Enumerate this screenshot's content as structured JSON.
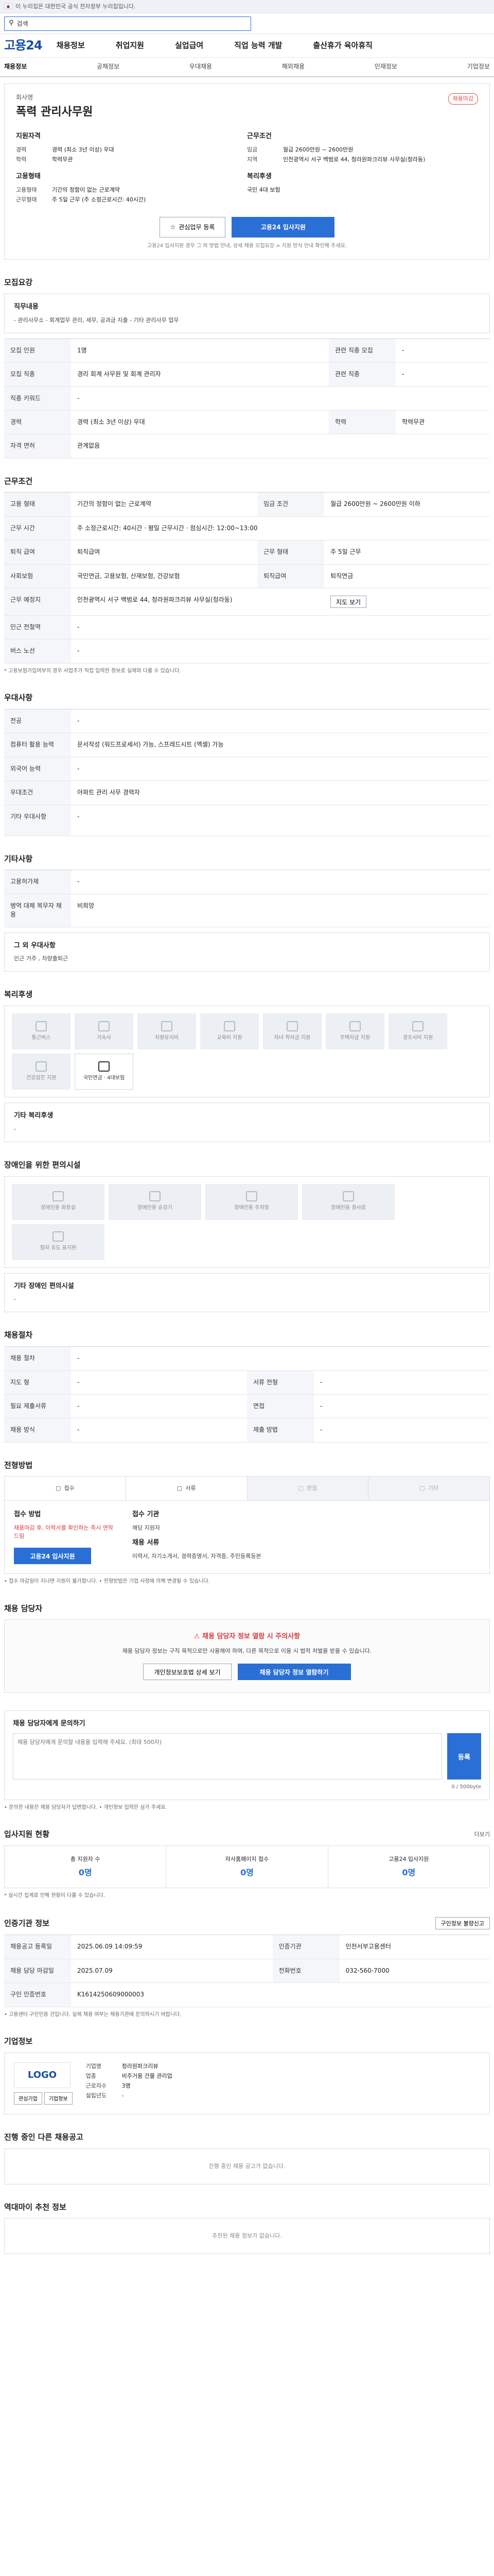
{
  "topbar": {
    "text": "이 누리집은 대한민국 공식 전자정부 누리집입니다."
  },
  "search": {
    "value": "검색",
    "placeholder": "검색어를 입력하세요"
  },
  "nav": {
    "logo": "고용24",
    "items": [
      "채용정보",
      "취업지원",
      "실업급여",
      "직업 능력 개발",
      "출산휴가 육아휴직"
    ]
  },
  "subnav": [
    "채용정보",
    "공채정보",
    "우대채용",
    "해외채용",
    "인재정보",
    "기업정보"
  ],
  "job": {
    "company": "회사명",
    "title": "폭력 관리사무원",
    "badge": "채용마감",
    "left_title": "지원자격",
    "left": [
      {
        "k": "경력",
        "v": "경력 (최소 3년 이상) 우대"
      },
      {
        "k": "학력",
        "v": "학력무관"
      }
    ],
    "left2_title": "고용형태",
    "left2": [
      {
        "k": "고용형태",
        "v": "기간의 정함이 없는 근로계약"
      },
      {
        "k": "근무형태",
        "v": "주 5일 근무 (주 소정근로시간: 40시간)"
      }
    ],
    "right_title": "근무조건",
    "right": [
      {
        "k": "임금",
        "v": "월급 2600만원 ~ 2600만원"
      },
      {
        "k": "지역",
        "v": "인천광역시 서구 백범로 44, 청라원파크리뷰 사무실(청라동)"
      }
    ],
    "right2_title": "복리후생",
    "right2": [
      {
        "k": "",
        "v": "국민 4대 보험"
      }
    ],
    "btn_interest": "관심업무 등록",
    "btn_apply": "고용24 입사지원",
    "apply_note": "고용24 입사지원 경우 그 외 방법 안내, 상세 채용 모집요강 > 지원 방식 안내 확인해 주세요."
  },
  "recruit": {
    "title": "모집요강",
    "duty_h": "직무내용",
    "duty": "- 관리사무소 - 회계업무 관리, 세무, 공과금 지출 - 기타 관리사무 업무",
    "rows": [
      {
        "th": "모집 인원",
        "td": "1명",
        "th2": "관련 직종 모집",
        "td2": "-"
      },
      {
        "th": "모집 직종",
        "td": "경리 회계 사무원 및 회계 관리자",
        "th2": "관련 직종",
        "td2": "-"
      },
      {
        "th": "직종 키워드",
        "td": "-",
        "th2": "",
        "td2": ""
      },
      {
        "th": "경력",
        "td": "경력 (최소 3년 이상) 우대",
        "th2": "학력",
        "td2": "학력무관"
      },
      {
        "th": "자격 면허",
        "td": "관계없음",
        "th2": "",
        "td2": ""
      }
    ]
  },
  "conditions": {
    "title": "근무조건",
    "rows": [
      {
        "th": "고용 형태",
        "td": "기간의 정함이 없는 근로계약",
        "th2": "임금 조건",
        "td2": "월급 2600만원 ~ 2600만원 이하"
      },
      {
        "th": "근무 시간",
        "td": "주 소정근로시간: 40시간 · 평일 근무시간 · 점심시간: 12:00~13:00",
        "th2": "",
        "td2": ""
      },
      {
        "th": "퇴직 급여",
        "td": "퇴직급여",
        "th2": "근무 형태",
        "td2": "주 5일 근무"
      },
      {
        "th": "사회보험",
        "td": "국민연금, 고용보험, 산재보험, 건강보험",
        "th2": "퇴직급여",
        "td2": "퇴직연금"
      },
      {
        "th": "근무 예정지",
        "td": "인천광역시 서구 백범로 44, 청라원파크리뷰 사무실(청라동)",
        "th2": "",
        "td2": ""
      },
      {
        "th": "인근 전철역",
        "td": "-",
        "th2": "",
        "td2": ""
      },
      {
        "th": "버스 노선",
        "td": "-",
        "th2": "",
        "td2": ""
      }
    ],
    "map_btn": "지도 보기",
    "note": "* 고용보험가입여부의 경우 사업주가 직접 입력한 정보로 실제와 다를 수 있습니다."
  },
  "pref": {
    "title": "우대사항",
    "rows": [
      {
        "th": "전공",
        "td": "-"
      },
      {
        "th": "컴퓨터 활용 능력",
        "td": "문서작성 (워드프로세서) 가능, 스프레드시트 (엑셀) 가능"
      },
      {
        "th": "외국어 능력",
        "td": "-"
      },
      {
        "th": "우대조건",
        "td": "아파트 관리 사무 경력자"
      },
      {
        "th": "기타 우대사항",
        "td": "-"
      }
    ]
  },
  "etc": {
    "title": "기타사항",
    "rows": [
      {
        "th": "고용허가제",
        "td": "-"
      },
      {
        "th": "병역 대체 복무자 채용",
        "td": "비희망"
      }
    ],
    "other_h": "그 외 우대사항",
    "other": "인근 거주 , 차량출퇴근"
  },
  "welfare": {
    "title": "복리후생",
    "items": [
      "통근버스",
      "기숙사",
      "차량유지비",
      "교육비 지원",
      "자녀 학자금 지원",
      "주택자금 지원",
      "경조사비 지원",
      "건강검진 지원",
      "국민연금 · 4대보험"
    ]
  },
  "facility": {
    "title": "기타 복리후생",
    "value": "-"
  },
  "disabled": {
    "title": "장애인을 위한 편의시설",
    "items": [
      "장애인용 화장실",
      "장애인용 승강기",
      "장애인용 주차장",
      "장애인용 경사로",
      "점자 유도 표지판"
    ],
    "other_h": "기타 장애인 편의시설",
    "other": "-"
  },
  "process": {
    "title": "채용절차",
    "rows": [
      {
        "th": "채용 절차",
        "td": "-",
        "th2": "",
        "td2": ""
      },
      {
        "th": "지도 형",
        "td": "-",
        "th2": "서류 전형",
        "td2": "-"
      },
      {
        "th": "필요 제출서류",
        "td": "-",
        "th2": "면접",
        "td2": "-"
      },
      {
        "th": "채용 방식",
        "td": "-",
        "th2": "제출 방법",
        "td2": "-"
      }
    ]
  },
  "progress": {
    "title": "전형방법",
    "steps": [
      "접수",
      "서류",
      "면접",
      "기타"
    ],
    "a_h": "접수 방법",
    "a": "채용마감 후, 이력서를 확인하는 즉시 연락드림",
    "b_h": "접수 기관",
    "b": "해당 지원자",
    "c_h": "채용 서류",
    "c": "이력서, 자기소개서, 경력증명서, 자격증, 주민등록등본",
    "apply_btn": "고용24 입사지원",
    "notes": "• 접수 마감일이 지나면 지원이 불가합니다. • 전형방법은 기업 사정에 의해 변경될 수 있습니다."
  },
  "contact": {
    "title": "채용 담당자",
    "warn": "채용 담당자 정보 열람 시 주의사항",
    "warn_text": "채용 담당자 정보는 구직 목적으로만 사용해야 하며, 다른 목적으로 이용 시 법적 처벌을 받을 수 있습니다.",
    "btn1": "개인정보보호법 상세 보기",
    "btn2": "채용 담당자 정보 열람하기"
  },
  "qa": {
    "title": "채용 담당자에게 문의하기",
    "placeholder": "채용 담당자에게 문의할 내용을 입력해 주세요. (최대 500자)",
    "count": "0 / 500byte",
    "btn": "등록",
    "notes": "• 문의한 내용은 채용 담당자가 답변합니다. • 개인정보 입력은 삼가 주세요."
  },
  "applicants": {
    "title": "입사지원 현황",
    "more": "더보기",
    "items": [
      {
        "label": "총 지원자 수",
        "value": "0명"
      },
      {
        "label": "자사홈페이지 접수",
        "value": "0명"
      },
      {
        "label": "고용24 입사지원",
        "value": "0명"
      }
    ],
    "note": "* 실시간 집계로 인해 현황이 다를 수 있습니다."
  },
  "info": {
    "title": "인증기관 정보",
    "btn": "구인정보 불량신고",
    "rows": [
      {
        "th": "채용공고 등록일",
        "td": "2025.06.09 14:09:59",
        "th2": "인증기관",
        "td2": "인천서부고용센터"
      },
      {
        "th": "채용 담당 마감일",
        "td": "2025.07.09",
        "th2": "전화번호",
        "td2": "032-560-7000"
      },
      {
        "th": "구인 인증번호",
        "td": "K1614250609000003",
        "th2": "",
        "td2": ""
      }
    ],
    "note": "• 고용센터 구인인증 건입니다. 실제 채용 여부는 채용기관에 문의하시기 바랍니다."
  },
  "company": {
    "title": "기업정보",
    "logo": "LOGO",
    "btn1": "관심기업",
    "btn2": "기업정보",
    "rows": [
      {
        "k": "기업명",
        "v": "청라원파크리뷰"
      },
      {
        "k": "업종",
        "v": "비주거용 건물 관리업"
      },
      {
        "k": "근로자수",
        "v": "3명"
      },
      {
        "k": "설립년도",
        "v": "-"
      }
    ]
  },
  "other_jobs": {
    "title": "진행 중인 다른 채용공고",
    "empty": "진행 중인 채용 공고가 없습니다."
  },
  "recommend": {
    "title": "역대마이 추천 정보",
    "empty": "추천된 채용 정보가 없습니다."
  }
}
